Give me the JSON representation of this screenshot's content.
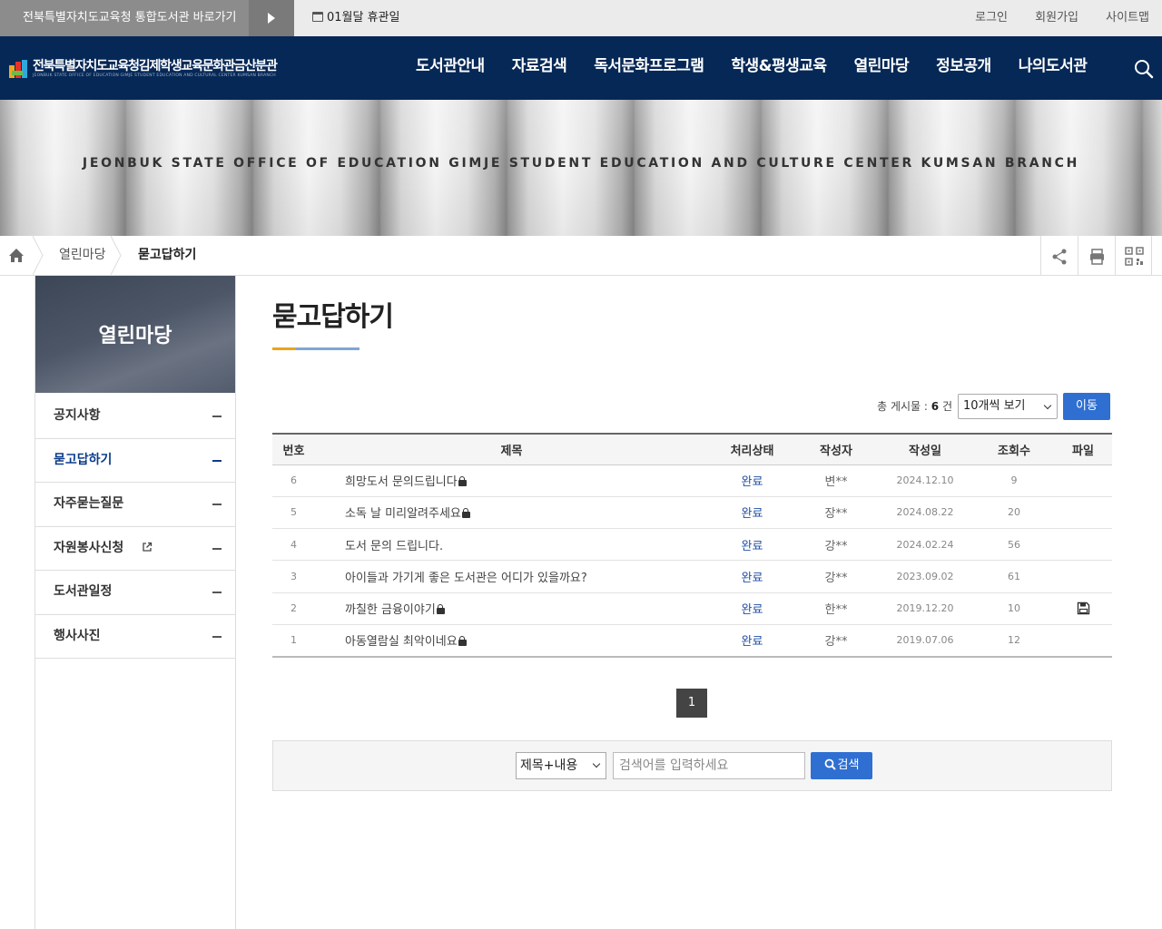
{
  "topbar": {
    "portal_link": "전북특별자치도교육청 통합도서관 바로가기",
    "closed_notice": "01월달 휴관일",
    "util_links": [
      "로그인",
      "회원가입",
      "사이트맵"
    ]
  },
  "header": {
    "logo_title": "전북특별자치도교육청김제학생교육문화관금산분관",
    "logo_sub": "JEONBUK STATE OFFICE OF EDUCATION GIMJE STUDENT EDUCATION AND CULTURAL CENTER KUMSAN BRANCH",
    "nav": [
      "도서관안내",
      "자료검색",
      "독서문화프로그램",
      "학생&평생교육",
      "열린마당",
      "정보공개",
      "나의도서관"
    ]
  },
  "banner": {
    "slogan": "JEONBUK STATE OFFICE OF EDUCATION GIMJE STUDENT EDUCATION AND CULTURE CENTER KUMSAN BRANCH"
  },
  "breadcrumb": {
    "items": [
      "열린마당",
      "묻고답하기"
    ]
  },
  "sidebar": {
    "title": "열린마당",
    "items": [
      {
        "label": "공지사항"
      },
      {
        "label": "묻고답하기"
      },
      {
        "label": "자주묻는질문"
      },
      {
        "label": "자원봉사신청"
      },
      {
        "label": "도서관일정"
      },
      {
        "label": "행사사진"
      }
    ]
  },
  "page": {
    "title": "묻고답하기"
  },
  "board": {
    "total_label": "총 게시물 : ",
    "total_count": "6",
    "total_unit": " 건",
    "per_page": "10개씩 보기",
    "go_label": "이동",
    "columns": [
      "번호",
      "제목",
      "처리상태",
      "작성자",
      "작성일",
      "조회수",
      "파일"
    ],
    "rows": [
      {
        "no": "6",
        "title": "희망도서 문의드립니다",
        "locked": true,
        "status": "완료",
        "writer": "변**",
        "date": "2024.12.10",
        "views": "9",
        "file": false
      },
      {
        "no": "5",
        "title": "소독 날 미리알려주세요",
        "locked": true,
        "status": "완료",
        "writer": "장**",
        "date": "2024.08.22",
        "views": "20",
        "file": false
      },
      {
        "no": "4",
        "title": "도서 문의 드립니다.",
        "locked": false,
        "status": "완료",
        "writer": "강**",
        "date": "2024.02.24",
        "views": "56",
        "file": false
      },
      {
        "no": "3",
        "title": "아이들과 가기게 좋은 도서관은 어디가 있을까요?",
        "locked": false,
        "status": "완료",
        "writer": "강**",
        "date": "2023.09.02",
        "views": "61",
        "file": false
      },
      {
        "no": "2",
        "title": "까칠한 금융이야기",
        "locked": true,
        "status": "완료",
        "writer": "한**",
        "date": "2019.12.20",
        "views": "10",
        "file": true
      },
      {
        "no": "1",
        "title": "아동열람실 최악이네요",
        "locked": true,
        "status": "완료",
        "writer": "강**",
        "date": "2019.07.06",
        "views": "12",
        "file": false
      }
    ],
    "current_page": "1"
  },
  "search": {
    "field_option": "제목+내용",
    "placeholder": "검색어를 입력하세요",
    "button_label": "검색"
  },
  "colors": {
    "header_bg": "#062856",
    "accent_blue": "#2f6fd2",
    "title_bar_orange": "#e7a51d",
    "title_bar_blue": "#7ea6d3",
    "status_text": "#1f4fa6"
  }
}
